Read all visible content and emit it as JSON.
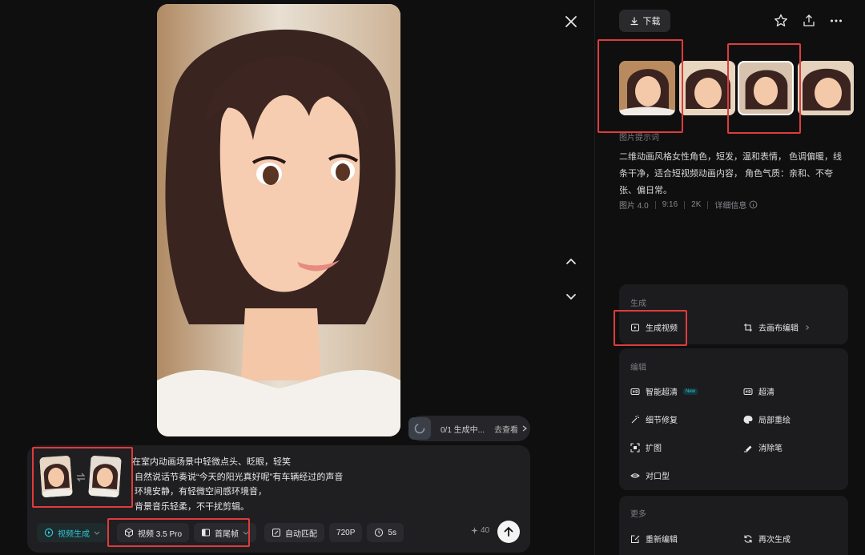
{
  "viewer": {
    "queue_status": "0/1 生成中...",
    "queue_link": "去查看"
  },
  "composer": {
    "prompt_lines": [
      "在室内动画场景中轻微点头、眨眼，轻笑",
      "自然说话节奏说“今天的阳光真好呢”有车辆经过的声音",
      "环境安静，有轻微空间感环境音，",
      "背景音乐轻柔，不干扰剪辑。"
    ],
    "mode": "视频生成",
    "model": "视频 3.5 Pro",
    "frame_mode": "首尾帧",
    "ratio": "自动匹配",
    "resolution": "720P",
    "duration": "5s",
    "credits": "40"
  },
  "panel": {
    "download_label": "下载",
    "prompt_section_title": "图片提示词",
    "prompt_text": "二维动画风格女性角色，短发，温和表情， 色调偏暖，线条干净，适合短视频动画内容， 角色气质：亲和、不夸张、偏日常。",
    "meta": {
      "model": "图片 4.0",
      "ratio": "9:16",
      "resolution": "2K",
      "details": "详细信息"
    },
    "generate": {
      "title": "生成",
      "generate_video": "生成视频",
      "canvas_edit": "去画布编辑"
    },
    "edit": {
      "title": "编辑",
      "smart_upscale": "智能超清",
      "new_badge": "New",
      "upscale": "超清",
      "detail_fix": "细节修复",
      "local_repaint": "局部重绘",
      "expand": "扩图",
      "eraser": "消除笔",
      "lip_sync": "对口型"
    },
    "more": {
      "title": "更多",
      "re_edit": "重新编辑",
      "regenerate": "再次生成"
    }
  },
  "colors": {
    "background": "#0f0f10",
    "panel_card": "#1c1c1f",
    "accent": "#2fc8d6",
    "highlight": "#e03b3b"
  }
}
